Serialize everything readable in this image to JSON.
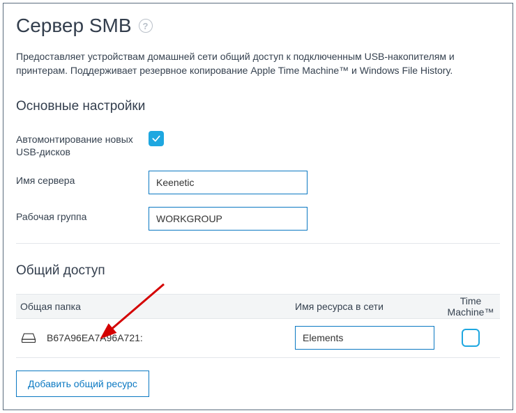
{
  "header": {
    "title": "Сервер SMB",
    "help_glyph": "?"
  },
  "description": "Предоставляет устройствам домашней сети общий доступ к подключенным USB-накопителям и принтерам. Поддерживает резервное копирование Apple Time Machine™ и Windows File History.",
  "basic": {
    "title": "Основные настройки",
    "automount_label": "Автомонтирование новых USB-дисков",
    "automount_checked": true,
    "server_name_label": "Имя сервера",
    "server_name_value": "Keenetic",
    "workgroup_label": "Рабочая группа",
    "workgroup_value": "WORKGROUP"
  },
  "sharing": {
    "title": "Общий доступ",
    "col_folder": "Общая папка",
    "col_resource": "Имя ресурса в сети",
    "col_tm": "Time Machine™",
    "rows": [
      {
        "folder": "B67A96EA7A96A721:",
        "resource": "Elements",
        "tm_checked": false
      }
    ],
    "add_btn": "Добавить общий ресурс"
  }
}
